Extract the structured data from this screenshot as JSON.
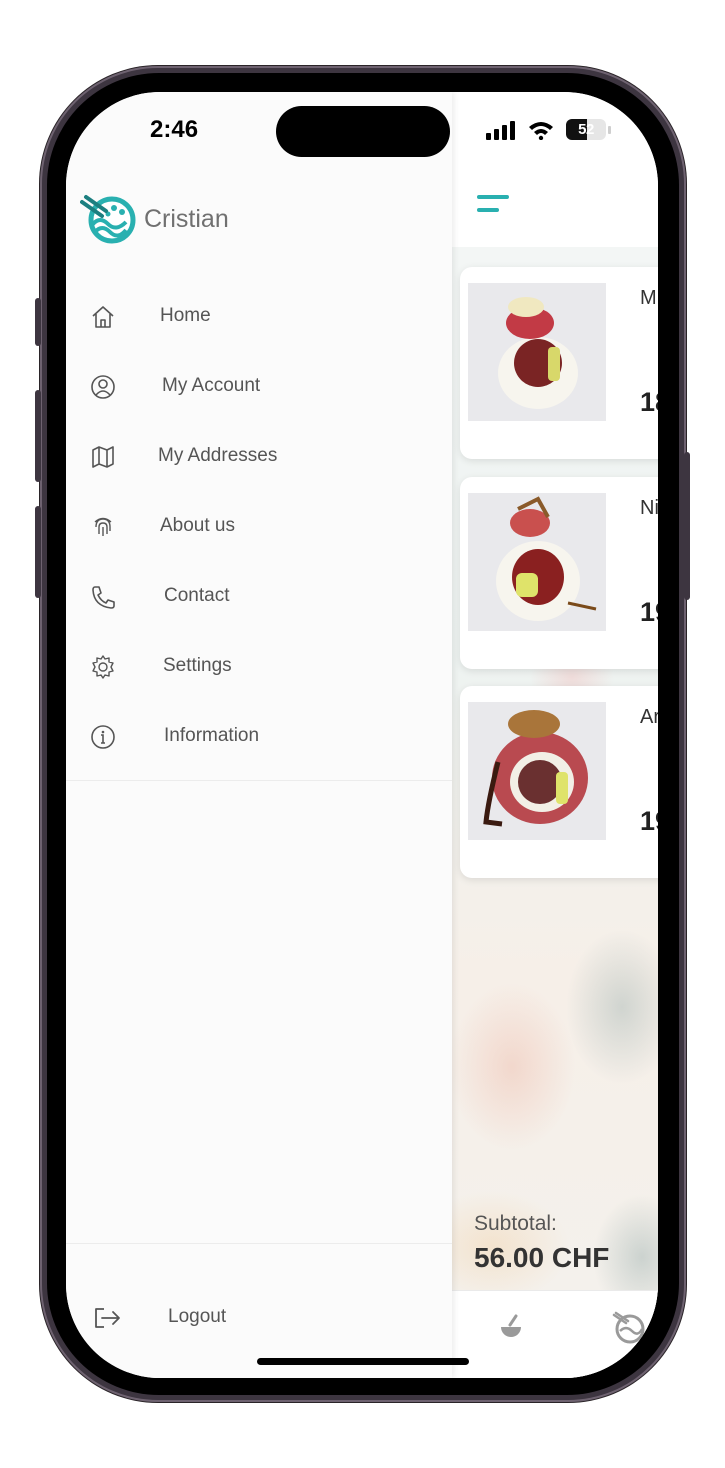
{
  "status_bar": {
    "time": "2:46",
    "battery_level": "52",
    "battery_fraction": 0.52
  },
  "drawer": {
    "user_name": "Cristian",
    "logo_icon": "sushi-logo-icon",
    "items": [
      {
        "label": "Home",
        "icon": "home-icon"
      },
      {
        "label": "My Account",
        "icon": "account-icon"
      },
      {
        "label": "My Addresses",
        "icon": "map-icon"
      },
      {
        "label": "About us",
        "icon": "fingerprint-icon"
      },
      {
        "label": "Contact",
        "icon": "phone-icon"
      },
      {
        "label": "Settings",
        "icon": "gear-icon"
      },
      {
        "label": "Information",
        "icon": "info-icon"
      }
    ],
    "logout_label": "Logout"
  },
  "cart": {
    "items": [
      {
        "name": "M",
        "price": "18"
      },
      {
        "name": "Ni",
        "price": "19"
      },
      {
        "name": "Ar",
        "price": "19"
      }
    ],
    "subtotal_label": "Subtotal:",
    "subtotal_value": "56.00 CHF"
  },
  "tabbar": {
    "icons": [
      "bowl-icon",
      "sushi-logo-icon"
    ]
  },
  "colors": {
    "accent": "#29b0b0",
    "text_muted": "#707070",
    "icon_gray": "#555555"
  }
}
